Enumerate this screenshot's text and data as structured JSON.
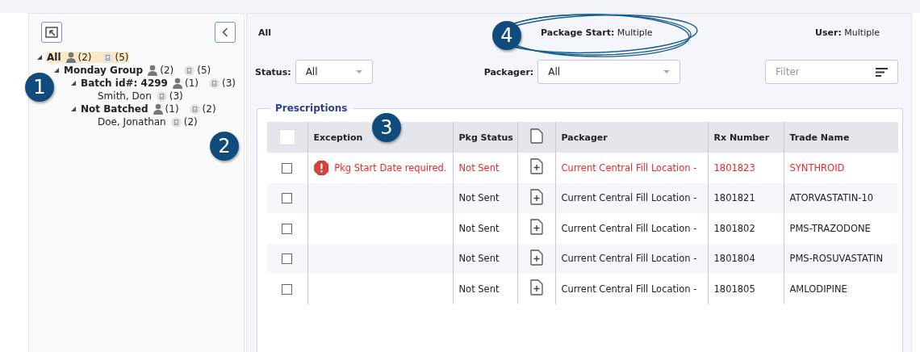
{
  "sidebar": {
    "tree": [
      {
        "label": "All",
        "selected": true,
        "expanded": true,
        "users": "(2)",
        "documents": "(5)",
        "children": [
          {
            "label": "Monday Group",
            "selected": false,
            "expanded": true,
            "users": "(2)",
            "documents": "(5)",
            "children": [
              {
                "label": "Batch id#: 4299",
                "selected": false,
                "expanded": true,
                "users": "(1)",
                "documents": "(3)",
                "children": [
                  {
                    "label": "Smith, Don",
                    "selected": false,
                    "documents": "(3)"
                  }
                ]
              },
              {
                "label": "Not Batched",
                "selected": false,
                "expanded": true,
                "users": "(1)",
                "documents": "(2)",
                "children": [
                  {
                    "label": "Doe, Jonathan",
                    "selected": false,
                    "documents": "(2)"
                  }
                ]
              }
            ]
          }
        ]
      }
    ]
  },
  "header": {
    "scope": "All",
    "package_start_label": "Package Start:",
    "package_start_value": "Multiple",
    "user_label": "User:",
    "user_value": "Multiple"
  },
  "filters": {
    "status_label": "Status:",
    "status_value": "All",
    "packager_label": "Packager:",
    "packager_value": "All",
    "filter_placeholder": "Filter"
  },
  "prescriptions": {
    "title": "Prescriptions",
    "select_all_checked": false,
    "columns": [
      "Exception",
      "Pkg Status",
      "Packager",
      "Rx Number",
      "Trade Name"
    ],
    "rows": [
      {
        "checked": false,
        "error": true,
        "exception": "Pkg Start Date required.",
        "pkg_status": "Not Sent",
        "packager": "Current Central Fill Location -",
        "rx_number": "1801823",
        "trade_name": "SYNTHROID"
      },
      {
        "checked": false,
        "error": false,
        "pkg_status": "Not Sent",
        "packager": "Current Central Fill Location -",
        "rx_number": "1801821",
        "trade_name": "ATORVASTATIN-10"
      },
      {
        "checked": false,
        "error": false,
        "pkg_status": "Not Sent",
        "packager": "Current Central Fill Location -",
        "rx_number": "1801802",
        "trade_name": "PMS-TRAZODONE"
      },
      {
        "checked": false,
        "error": false,
        "pkg_status": "Not Sent",
        "packager": "Current Central Fill Location -",
        "rx_number": "1801804",
        "trade_name": "PMS-ROSUVASTATIN"
      },
      {
        "checked": false,
        "error": false,
        "pkg_status": "Not Sent",
        "packager": "Current Central Fill Location -",
        "rx_number": "1801805",
        "trade_name": "AMLODIPINE"
      }
    ]
  },
  "callouts": [
    "1",
    "2",
    "3",
    "4"
  ]
}
